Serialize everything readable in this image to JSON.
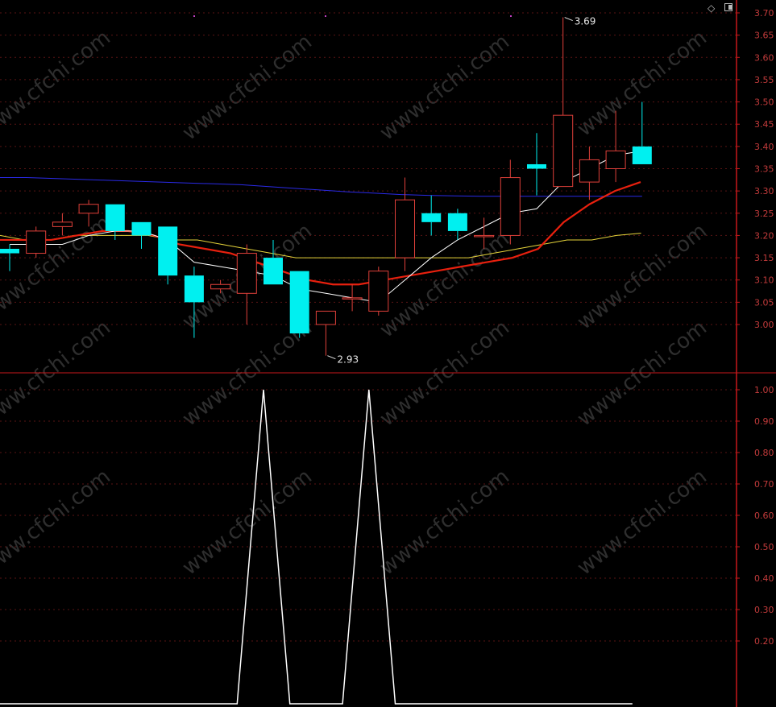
{
  "watermark": "www.cfchi.com",
  "toolbar": {
    "diamond_icon": "diamond-icon",
    "panel_icon": "panel-toggle-icon"
  },
  "colors": {
    "background": "#000000",
    "axis": "#c8191b",
    "grid": "#5a1414",
    "up_candle": "#e0403a",
    "down_candle": "#00f0f0",
    "ma5": "#ffffff",
    "ma10": "#e8200e",
    "ma20": "#e6d43a",
    "ma60": "#2a2ae6",
    "indicator": "#ffffff"
  },
  "chart_data": [
    {
      "type": "candlestick",
      "title": "",
      "y_ticks": [
        "3.70",
        "3.65",
        "3.60",
        "3.55",
        "3.50",
        "3.45",
        "3.40",
        "3.35",
        "3.30",
        "3.25",
        "3.20",
        "3.15",
        "3.10",
        "3.05",
        "3.00"
      ],
      "ylim": [
        2.88,
        3.72
      ],
      "candles": [
        {
          "o": 3.17,
          "h": 3.18,
          "l": 3.12,
          "c": 3.16
        },
        {
          "o": 3.16,
          "h": 3.22,
          "l": 3.15,
          "c": 3.21
        },
        {
          "o": 3.22,
          "h": 3.25,
          "l": 3.2,
          "c": 3.23
        },
        {
          "o": 3.25,
          "h": 3.28,
          "l": 3.22,
          "c": 3.27
        },
        {
          "o": 3.27,
          "h": 3.27,
          "l": 3.19,
          "c": 3.21
        },
        {
          "o": 3.23,
          "h": 3.23,
          "l": 3.17,
          "c": 3.2
        },
        {
          "o": 3.22,
          "h": 3.22,
          "l": 3.09,
          "c": 3.11
        },
        {
          "o": 3.11,
          "h": 3.13,
          "l": 2.97,
          "c": 3.05
        },
        {
          "o": 3.08,
          "h": 3.1,
          "l": 3.07,
          "c": 3.09
        },
        {
          "o": 3.07,
          "h": 3.18,
          "l": 3.0,
          "c": 3.16
        },
        {
          "o": 3.15,
          "h": 3.19,
          "l": 3.09,
          "c": 3.09
        },
        {
          "o": 3.12,
          "h": 3.12,
          "l": 2.97,
          "c": 2.98
        },
        {
          "o": 3.0,
          "h": 3.03,
          "l": 2.93,
          "c": 3.03
        },
        {
          "o": 3.06,
          "h": 3.09,
          "l": 3.03,
          "c": 3.06
        },
        {
          "o": 3.03,
          "h": 3.13,
          "l": 3.02,
          "c": 3.12
        },
        {
          "o": 3.15,
          "h": 3.33,
          "l": 3.12,
          "c": 3.28
        },
        {
          "o": 3.25,
          "h": 3.29,
          "l": 3.2,
          "c": 3.23
        },
        {
          "o": 3.25,
          "h": 3.26,
          "l": 3.19,
          "c": 3.21
        },
        {
          "o": 3.2,
          "h": 3.24,
          "l": 3.17,
          "c": 3.2
        },
        {
          "o": 3.2,
          "h": 3.37,
          "l": 3.18,
          "c": 3.33
        },
        {
          "o": 3.36,
          "h": 3.43,
          "l": 3.29,
          "c": 3.35
        },
        {
          "o": 3.31,
          "h": 3.69,
          "l": 3.31,
          "c": 3.47
        },
        {
          "o": 3.32,
          "h": 3.4,
          "l": 3.28,
          "c": 3.37
        },
        {
          "o": 3.35,
          "h": 3.48,
          "l": 3.32,
          "c": 3.39
        },
        {
          "o": 3.4,
          "h": 3.5,
          "l": 3.37,
          "c": 3.36
        }
      ],
      "ma5": [
        3.18,
        3.18,
        3.18,
        3.2,
        3.21,
        3.21,
        3.19,
        3.14,
        3.13,
        3.12,
        3.11,
        3.08,
        3.07,
        3.06,
        3.05,
        3.1,
        3.15,
        3.19,
        3.22,
        3.25,
        3.26,
        3.32,
        3.35,
        3.38,
        3.39
      ],
      "ma10": [
        3.19,
        3.19,
        3.19,
        3.2,
        3.21,
        3.21,
        3.2,
        3.18,
        3.17,
        3.16,
        3.14,
        3.12,
        3.1,
        3.09,
        3.09,
        3.1,
        3.11,
        3.12,
        3.13,
        3.14,
        3.15,
        3.17,
        3.23,
        3.27,
        3.3,
        3.32
      ],
      "ma20": [
        3.2,
        3.19,
        3.19,
        3.2,
        3.2,
        3.2,
        3.2,
        3.19,
        3.19,
        3.18,
        3.17,
        3.16,
        3.15,
        3.15,
        3.15,
        3.15,
        3.15,
        3.15,
        3.15,
        3.15,
        3.16,
        3.17,
        3.18,
        3.19,
        3.19,
        3.2,
        3.205
      ],
      "ma60": [
        3.33,
        3.33,
        3.328,
        3.326,
        3.324,
        3.322,
        3.32,
        3.318,
        3.316,
        3.314,
        3.31,
        3.306,
        3.302,
        3.298,
        3.295,
        3.292,
        3.29,
        3.289,
        3.288,
        3.288,
        3.288,
        3.288,
        3.288,
        3.288,
        3.288
      ],
      "annotations": [
        {
          "label": "3.69",
          "value": 3.69,
          "index": 21
        },
        {
          "label": "2.93",
          "value": 2.93,
          "index": 12
        }
      ]
    },
    {
      "type": "line",
      "title": "",
      "y_ticks": [
        "1.00",
        "0.90",
        "0.80",
        "0.70",
        "0.60",
        "0.50",
        "0.40",
        "0.30",
        "0.20"
      ],
      "ylim": [
        0,
        1.0
      ],
      "series": [
        {
          "values": [
            0,
            0,
            0,
            0,
            0,
            0,
            0,
            0,
            0,
            0,
            1,
            0,
            0,
            0,
            1,
            0,
            0,
            0,
            0,
            0,
            0,
            0,
            0,
            0,
            0
          ]
        }
      ]
    }
  ]
}
